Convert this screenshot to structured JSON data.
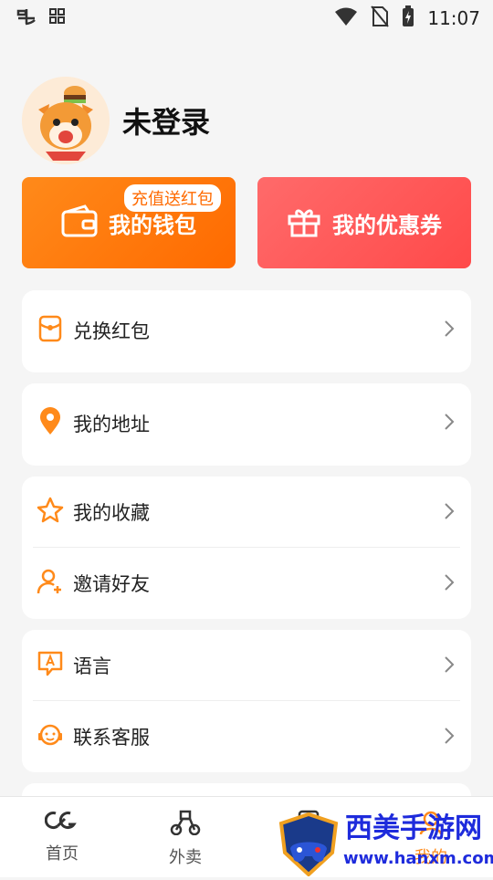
{
  "status_bar": {
    "time": "11:07"
  },
  "profile": {
    "status": "未登录"
  },
  "cards": {
    "wallet": {
      "label": "我的钱包",
      "badge": "充值送红包"
    },
    "coupon": {
      "label": "我的优惠券"
    }
  },
  "menu": {
    "redeem": "兑换红包",
    "address": "我的地址",
    "favorites": "我的收藏",
    "invite": "邀请好友",
    "language": "语言",
    "service": "联系客服"
  },
  "bottom_nav": [
    {
      "label": "首页",
      "icon": "home-icon"
    },
    {
      "label": "外卖",
      "icon": "scooter-icon"
    },
    {
      "label": "",
      "icon": "orders-icon"
    },
    {
      "label": "我的",
      "icon": "profile-icon"
    }
  ],
  "watermark": {
    "text": "西美手游网",
    "url": "www.hanxm.com"
  },
  "colors": {
    "accent": "#ff8a1a",
    "coupon": "#ff5a5a"
  }
}
